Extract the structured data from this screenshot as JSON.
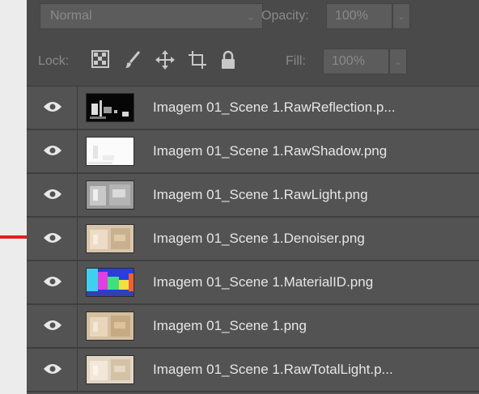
{
  "blend": {
    "mode": "Normal",
    "opacity_label": "Opacity:",
    "opacity_value": "100%"
  },
  "lock": {
    "label": "Lock:",
    "fill_label": "Fill:",
    "fill_value": "100%"
  },
  "layers": [
    {
      "name": "Imagem 01_Scene 1.RawReflection.p...",
      "thumb": "reflection",
      "visible": true
    },
    {
      "name": "Imagem 01_Scene 1.RawShadow.png",
      "thumb": "shadow",
      "visible": true
    },
    {
      "name": "Imagem 01_Scene 1.RawLight.png",
      "thumb": "light",
      "visible": true
    },
    {
      "name": "Imagem 01_Scene 1.Denoiser.png",
      "thumb": "denoiser",
      "visible": true,
      "highlighted_by_arrow": true
    },
    {
      "name": "Imagem 01_Scene 1.MaterialID.png",
      "thumb": "materialid",
      "visible": true
    },
    {
      "name": "Imagem 01_Scene 1.png",
      "thumb": "beauty",
      "visible": true
    },
    {
      "name": "Imagem 01_Scene 1.RawTotalLight.p...",
      "thumb": "totallight",
      "visible": true
    }
  ],
  "colors": {
    "panel": "#535353",
    "toolbar": "#4a4a4a",
    "text": "#e6e6e6",
    "arrow": "#e02020"
  },
  "icons": [
    "checkerboard-lock-icon",
    "brush-lock-icon",
    "move-lock-icon",
    "artboard-lock-icon",
    "padlock-icon",
    "eye-icon",
    "red-arrow-icon",
    "chevron-down-icon"
  ]
}
